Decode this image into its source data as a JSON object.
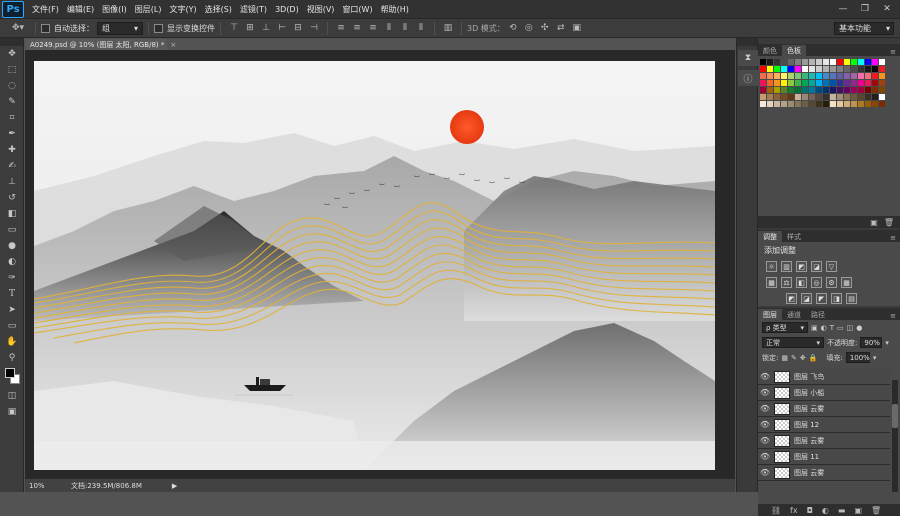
{
  "app": {
    "logo": "Ps"
  },
  "menu": [
    "文件(F)",
    "编辑(E)",
    "图像(I)",
    "图层(L)",
    "文字(Y)",
    "选择(S)",
    "滤镜(T)",
    "3D(D)",
    "视图(V)",
    "窗口(W)",
    "帮助(H)"
  ],
  "window_controls": {
    "minimize": "—",
    "restore": "❐",
    "close": "✕"
  },
  "options": {
    "auto_select_label": "自动选择：",
    "auto_select_value": "组",
    "show_transform_label": "显示变换控件",
    "mode3d_label": "3D 模式：",
    "workspace": "基本功能"
  },
  "document": {
    "tab_title": "A0249.psd @ 10% (图层 太阳, RGB/8) *",
    "tab_close": "×"
  },
  "status": {
    "zoom": "10%",
    "doc_info": "文档:239.5M/806.8M",
    "arrow": "▶"
  },
  "swatches_panel": {
    "tabs": [
      "颜色",
      "色板"
    ],
    "active_tab": 1,
    "colors": [
      "#000000",
      "#1a1a1a",
      "#333333",
      "#4d4d4d",
      "#666666",
      "#808080",
      "#999999",
      "#b3b3b3",
      "#cccccc",
      "#e6e6e6",
      "#ffffff",
      "#ff0000",
      "#ffff00",
      "#00ff00",
      "#00ffff",
      "#0000ff",
      "#ff00ff",
      "#ffffff",
      "#ff0000",
      "#ffff00",
      "#00ff00",
      "#00ffff",
      "#0000ff",
      "#ff00ff",
      "#ffffff",
      "#e5e5e5",
      "#cccccc",
      "#b2b2b2",
      "#999999",
      "#7f7f7f",
      "#666666",
      "#4c4c4c",
      "#333333",
      "#191919",
      "#000000",
      "#ed1c24",
      "#f26c4f",
      "#f68e56",
      "#fbaf5d",
      "#fff467",
      "#acd372",
      "#7cc576",
      "#3bb878",
      "#1abbb4",
      "#00bff3",
      "#438ccb",
      "#5574b9",
      "#605ca8",
      "#855fa8",
      "#a763a8",
      "#f06eaa",
      "#f26d7d",
      "#ed1c24",
      "#f7941d",
      "#ed145b",
      "#f26522",
      "#f7941d",
      "#fff200",
      "#8dc63f",
      "#39b54a",
      "#00a651",
      "#00a99d",
      "#00aeef",
      "#0072bc",
      "#0054a6",
      "#2e3192",
      "#662d91",
      "#92278f",
      "#ec008c",
      "#ed145b",
      "#9e0b0f",
      "#a0410d",
      "#9e0039",
      "#a3620a",
      "#aba000",
      "#598527",
      "#1a7b30",
      "#007236",
      "#00746b",
      "#0076a3",
      "#004b80",
      "#003471",
      "#1b1464",
      "#440e62",
      "#630460",
      "#9e005d",
      "#9e0039",
      "#790000",
      "#7b2e00",
      "#7d4900",
      "#c69c6d",
      "#a67c52",
      "#8c6239",
      "#754c24",
      "#603913",
      "#c7b299",
      "#998675",
      "#736357",
      "#534741",
      "#362f2d",
      "#c2b59b",
      "#a28e72",
      "#8b7456",
      "#6e5a3e",
      "#574530",
      "#3b2f22",
      "#231f20",
      "#ffffff",
      "#f5e9d8",
      "#e3d3be",
      "#cbb79f",
      "#b3a189",
      "#9b8b72",
      "#83755c",
      "#6b5f46",
      "#534931",
      "#3b331d",
      "#231d09",
      "#f4e2c8",
      "#e2c89f",
      "#d0ae76",
      "#be944d",
      "#ac7a24",
      "#9a6000",
      "#884600",
      "#762c00"
    ],
    "footer_icons": [
      "new-swatch",
      "trash"
    ]
  },
  "adjustments_panel": {
    "tabs": [
      "调整",
      "样式"
    ],
    "active_tab": 0,
    "title": "添加调整",
    "row1": [
      "☼",
      "▥",
      "◩",
      "◪",
      "▽"
    ],
    "row2": [
      "▦",
      "⚖",
      "◧",
      "◎",
      "⚙",
      "▦"
    ],
    "row3": [
      "◩",
      "◪",
      "◤",
      "◨",
      "▤"
    ]
  },
  "layers_panel": {
    "tabs": [
      "图层",
      "通道",
      "路径"
    ],
    "active_tab": 0,
    "filter_kind": "ρ 类型",
    "blend_mode": "正常",
    "opacity_label": "不透明度:",
    "opacity_value": "90%",
    "lock_label": "锁定:",
    "fill_label": "填充:",
    "fill_value": "100%",
    "layers": [
      {
        "name": "图层 飞鸟"
      },
      {
        "name": "图层 小船"
      },
      {
        "name": "图层 云雾"
      },
      {
        "name": "图层 12"
      },
      {
        "name": "图层 云雾"
      },
      {
        "name": "图层 11"
      },
      {
        "name": "图层 云雾"
      }
    ],
    "footer_icons": [
      "link",
      "fx",
      "mask",
      "adjustment",
      "group",
      "new-layer",
      "trash"
    ]
  },
  "tools": [
    "move",
    "marquee",
    "lasso",
    "quick-select",
    "crop",
    "eyedropper",
    "healing",
    "brush",
    "clone",
    "history-brush",
    "eraser",
    "gradient",
    "blur",
    "dodge",
    "pen",
    "type",
    "path-select",
    "shape",
    "hand",
    "zoom",
    "fg-bg-colors",
    "quick-mask",
    "screen-mode"
  ]
}
